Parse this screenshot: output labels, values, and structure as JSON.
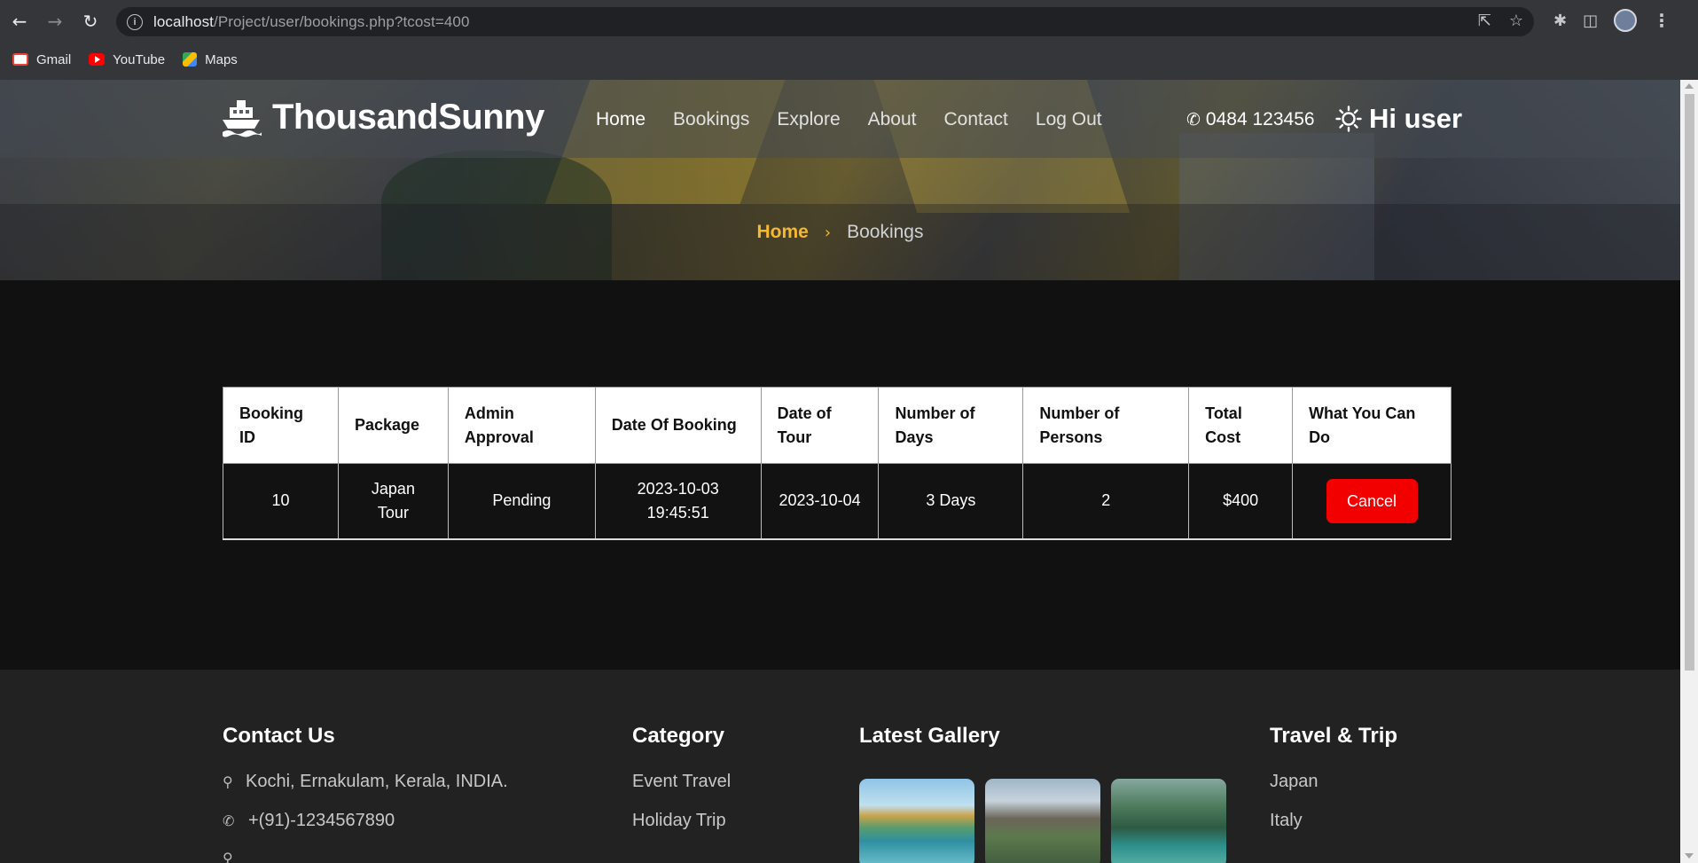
{
  "browser": {
    "url_host": "localhost",
    "url_path": "/Project/user/bookings.php?tcost=400",
    "bookmarks": [
      {
        "label": "Gmail"
      },
      {
        "label": "YouTube"
      },
      {
        "label": "Maps"
      }
    ]
  },
  "site": {
    "brand": "ThousandSunny",
    "nav": [
      "Home",
      "Bookings",
      "Explore",
      "About",
      "Contact",
      "Log Out"
    ],
    "phone": "0484 123456",
    "greeting": "Hi user"
  },
  "breadcrumb": {
    "home": "Home",
    "current": "Bookings"
  },
  "table": {
    "headers": [
      "Booking\nID",
      "Package",
      "Admin\nApproval",
      "Date Of Booking",
      "Date of\nTour",
      "Number of\nDays",
      "Number of\nPersons",
      "Total\nCost",
      "What You Can\nDo"
    ],
    "rows": [
      {
        "booking_id": "10",
        "package": "Japan\nTour",
        "admin_approval": "Pending",
        "date_of_booking": "2023-10-03\n19:45:51",
        "date_of_tour": "2023-10-04",
        "number_of_days": "3 Days",
        "number_of_persons": "2",
        "total_cost": "$400",
        "action": "Cancel"
      }
    ]
  },
  "footer": {
    "contact": {
      "title": "Contact Us",
      "address": "Kochi, Ernakulam, Kerala, INDIA.",
      "phone": "+(91)-1234567890"
    },
    "category": {
      "title": "Category",
      "items": [
        "Event Travel",
        "Holiday Trip"
      ]
    },
    "gallery": {
      "title": "Latest Gallery"
    },
    "travel": {
      "title": "Travel & Trip",
      "items": [
        "Japan",
        "Italy"
      ]
    }
  },
  "colors": {
    "accent": "#f5b82e",
    "cancel": "#f20000",
    "footer_bg": "#222222"
  },
  "icons": [
    "back-icon",
    "forward-icon",
    "reload-icon",
    "info-icon",
    "share-icon",
    "star-icon",
    "extensions-icon",
    "sidepanel-icon",
    "menu-icon",
    "ship-icon",
    "phone-icon",
    "sun-icon",
    "location-icon"
  ]
}
